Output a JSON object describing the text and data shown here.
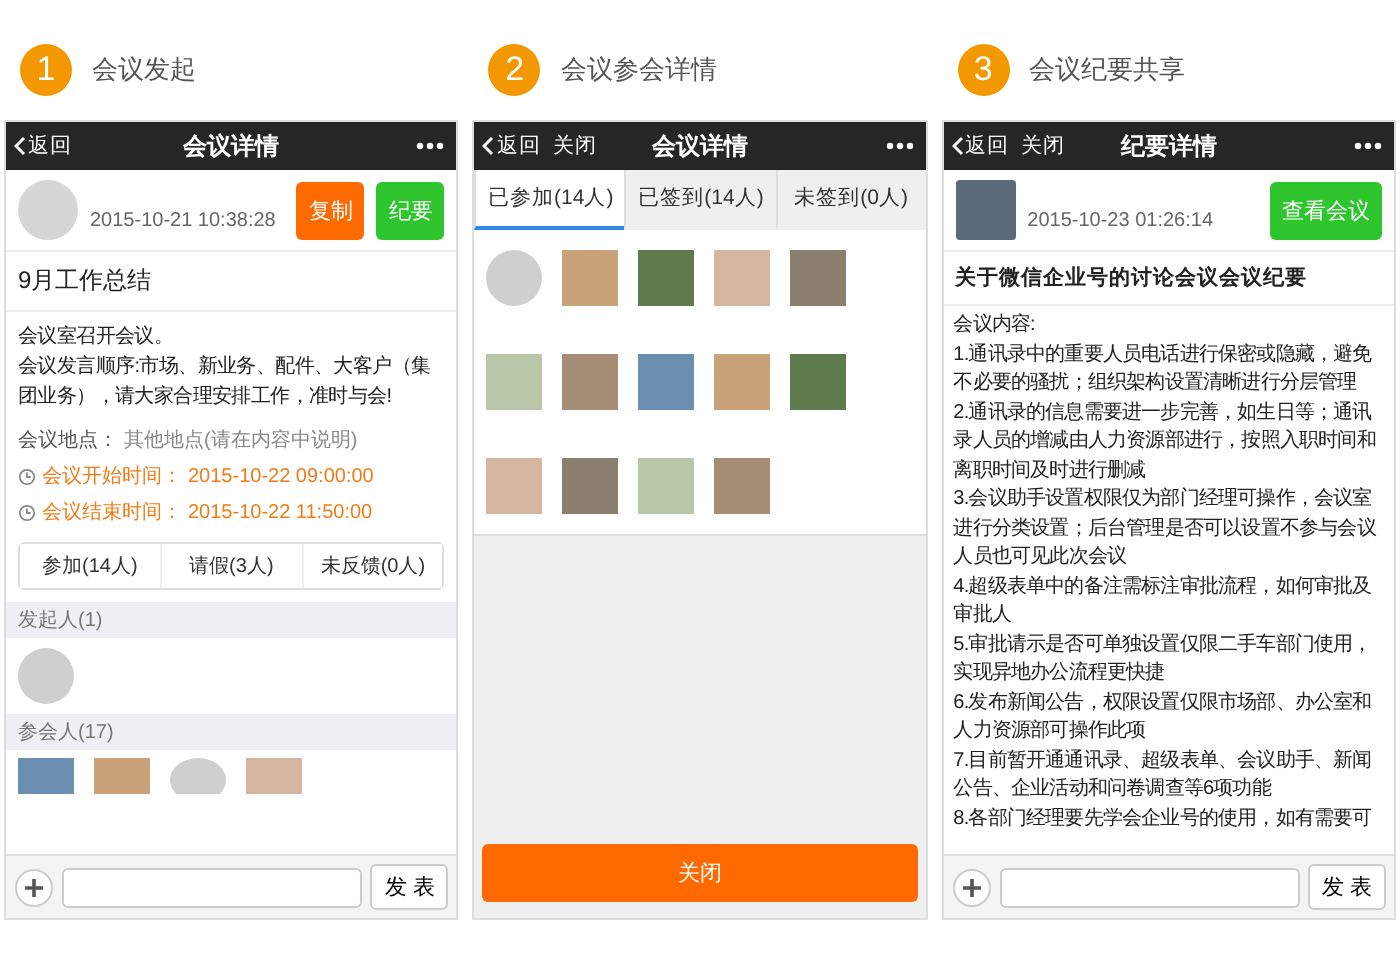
{
  "steps": [
    {
      "number": "1",
      "label": "会议发起"
    },
    {
      "number": "2",
      "label": "会议参会详情"
    },
    {
      "number": "3",
      "label": "会议纪要共享"
    }
  ],
  "screen_1": {
    "nav": {
      "back": "返回",
      "title": "会议详情"
    },
    "header": {
      "date": "2015-10-21 10:38:28",
      "buttons": [
        {
          "label": "复制",
          "color": "#ff6a00"
        },
        {
          "label": "纪要",
          "color": "#2ec52e"
        }
      ]
    },
    "title": "9月工作总结",
    "body": [
      "会议室召开会议。",
      "会议发言顺序:市场、新业务、配件、大客户（集团业务），请大家合理安排工作，准时与会!"
    ],
    "location": {
      "label": "会议地点：",
      "value": "其他地点(请在内容中说明)"
    },
    "times": [
      {
        "label": "会议开始时间：",
        "value": "2015-10-22 09:00:00"
      },
      {
        "label": "会议结束时间：",
        "value": "2015-10-22 11:50:00"
      }
    ],
    "responses": [
      "参加(14人)",
      "请假(3人)",
      "未反馈(0人)"
    ],
    "organizers": {
      "heading": "发起人(1)",
      "photos": [
        {
          "kind": "round"
        }
      ]
    },
    "attendees": {
      "heading": "参会人(17)",
      "photos": [
        {
          "kind": "square"
        },
        {
          "kind": "square"
        },
        {
          "kind": "round"
        },
        {
          "kind": "square"
        }
      ]
    },
    "composer": {
      "send": "发 表"
    }
  },
  "screen_2": {
    "nav": {
      "back": "返回",
      "close": "关闭",
      "title": "会议详情"
    },
    "tabs": [
      {
        "label": "已参加(14人)",
        "selected": true
      },
      {
        "label": "已签到(14人)",
        "selected": false
      },
      {
        "label": "未签到(0人)",
        "selected": false
      }
    ],
    "photos": [
      {
        "kind": "round"
      },
      {
        "kind": "square"
      },
      {
        "kind": "square"
      },
      {
        "kind": "square"
      },
      {
        "kind": "square"
      },
      {
        "kind": "square"
      },
      {
        "kind": "square"
      },
      {
        "kind": "square"
      },
      {
        "kind": "square"
      },
      {
        "kind": "square"
      },
      {
        "kind": "square"
      },
      {
        "kind": "square"
      },
      {
        "kind": "square"
      },
      {
        "kind": "square"
      }
    ],
    "close_button": "关闭"
  },
  "screen_3": {
    "nav": {
      "back": "返回",
      "close": "关闭",
      "title": "纪要详情"
    },
    "header": {
      "date": "2015-10-23 01:26:14",
      "button": "查看会议"
    },
    "title": "关于微信企业号的讨论会议会议纪要",
    "body": [
      "会议内容:",
      "1.通讯录中的重要人员电话进行保密或隐藏，避免不必要的骚扰；组织架构设置清晰进行分层管理",
      "2.通讯录的信息需要进一步完善，如生日等；通讯录人员的增减由人力资源部进行，按照入职时间和离职时间及时进行删减",
      "3.会议助手设置权限仅为部门经理可操作，会议室进行分类设置；后台管理是否可以设置不参与会议人员也可见此次会议",
      "4.超级表单中的备注需标注审批流程，如何审批及审批人",
      "5.审批请示是否可单独设置仅限二手车部门使用，实现异地办公流程更快捷",
      "6.发布新闻公告，权限设置仅限市场部、办公室和人力资源部可操作此项",
      "7.目前暂开通通讯录、超级表单、会议助手、新闻公告、企业活动和问卷调查等6项功能",
      "8.各部门经理要先学会企业号的使用，如有需要可"
    ],
    "composer": {
      "send": "发 表"
    }
  }
}
